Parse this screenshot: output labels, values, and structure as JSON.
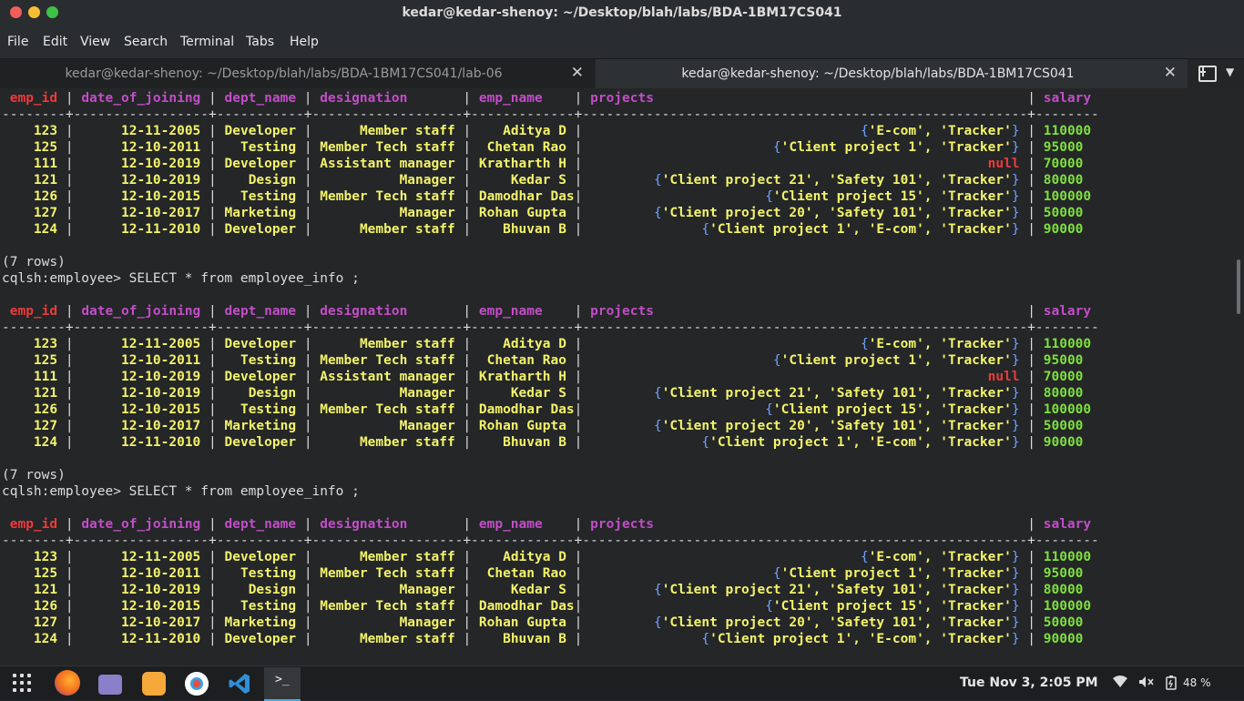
{
  "window": {
    "title": "kedar@kedar-shenoy: ~/Desktop/blah/labs/BDA-1BM17CS041"
  },
  "menubar": [
    "File",
    "Edit",
    "View",
    "Search",
    "Terminal",
    "Tabs",
    "Help"
  ],
  "tabs": [
    {
      "label": "kedar@kedar-shenoy: ~/Desktop/blah/labs/BDA-1BM17CS041/lab-06",
      "active": false
    },
    {
      "label": "kedar@kedar-shenoy: ~/Desktop/blah/labs/BDA-1BM17CS041",
      "active": true
    }
  ],
  "terminal": {
    "columns": [
      "emp_id",
      "date_of_joining",
      "dept_name",
      "designation",
      "emp_name",
      "projects",
      "salary"
    ],
    "separator": "--------+-----------------+-----------+-------------------+-------------+--------------------------------------------------------+--------",
    "row_count_text": "(7 rows)",
    "prompt": "cqlsh:employee> SELECT * from employee_info ;",
    "tables": [
      {
        "rows": [
          [
            "123",
            "12-11-2005",
            "Developer",
            "Member staff",
            "Aditya D",
            "{'E-com', 'Tracker'}",
            "110000"
          ],
          [
            "125",
            "12-10-2011",
            "Testing",
            "Member Tech staff",
            "Chetan Rao",
            "{'Client project 1', 'Tracker'}",
            "95000"
          ],
          [
            "111",
            "12-10-2019",
            "Developer",
            "Assistant manager",
            "Kratharth H",
            "null",
            "70000"
          ],
          [
            "121",
            "12-10-2019",
            "Design",
            "Manager",
            "Kedar S",
            "{'Client project 21', 'Safety 101', 'Tracker'}",
            "80000"
          ],
          [
            "126",
            "12-10-2015",
            "Testing",
            "Member Tech staff",
            "Damodhar Das",
            "{'Client project 15', 'Tracker'}",
            "100000"
          ],
          [
            "127",
            "12-10-2017",
            "Marketing",
            "Manager",
            "Rohan Gupta",
            "{'Client project 20', 'Safety 101', 'Tracker'}",
            "50000"
          ],
          [
            "124",
            "12-11-2010",
            "Developer",
            "Member staff",
            "Bhuvan B",
            "{'Client project 1', 'E-com', 'Tracker'}",
            "90000"
          ]
        ]
      },
      {
        "rows": [
          [
            "123",
            "12-11-2005",
            "Developer",
            "Member staff",
            "Aditya D",
            "{'E-com', 'Tracker'}",
            "110000"
          ],
          [
            "125",
            "12-10-2011",
            "Testing",
            "Member Tech staff",
            "Chetan Rao",
            "{'Client project 1', 'Tracker'}",
            "95000"
          ],
          [
            "111",
            "12-10-2019",
            "Developer",
            "Assistant manager",
            "Kratharth H",
            "null",
            "70000"
          ],
          [
            "121",
            "12-10-2019",
            "Design",
            "Manager",
            "Kedar S",
            "{'Client project 21', 'Safety 101', 'Tracker'}",
            "80000"
          ],
          [
            "126",
            "12-10-2015",
            "Testing",
            "Member Tech staff",
            "Damodhar Das",
            "{'Client project 15', 'Tracker'}",
            "100000"
          ],
          [
            "127",
            "12-10-2017",
            "Marketing",
            "Manager",
            "Rohan Gupta",
            "{'Client project 20', 'Safety 101', 'Tracker'}",
            "50000"
          ],
          [
            "124",
            "12-11-2010",
            "Developer",
            "Member staff",
            "Bhuvan B",
            "{'Client project 1', 'E-com', 'Tracker'}",
            "90000"
          ]
        ]
      },
      {
        "rows": [
          [
            "123",
            "12-11-2005",
            "Developer",
            "Member staff",
            "Aditya D",
            "{'E-com', 'Tracker'}",
            "110000"
          ],
          [
            "125",
            "12-10-2011",
            "Testing",
            "Member Tech staff",
            "Chetan Rao",
            "{'Client project 1', 'Tracker'}",
            "95000"
          ],
          [
            "121",
            "12-10-2019",
            "Design",
            "Manager",
            "Kedar S",
            "{'Client project 21', 'Safety 101', 'Tracker'}",
            "80000"
          ],
          [
            "126",
            "12-10-2015",
            "Testing",
            "Member Tech staff",
            "Damodhar Das",
            "{'Client project 15', 'Tracker'}",
            "100000"
          ],
          [
            "127",
            "12-10-2017",
            "Marketing",
            "Manager",
            "Rohan Gupta",
            "{'Client project 20', 'Safety 101', 'Tracker'}",
            "50000"
          ],
          [
            "124",
            "12-11-2010",
            "Developer",
            "Member staff",
            "Bhuvan B",
            "{'Client project 1', 'E-com', 'Tracker'}",
            "90000"
          ]
        ]
      }
    ]
  },
  "taskbar": {
    "apps": [
      "apps-grid-icon",
      "firefox-icon",
      "files-icon",
      "software-center-icon",
      "help-icon",
      "vscode-icon",
      "terminal-icon"
    ],
    "terminal_glyph": ">_",
    "clock": "Tue Nov  3,  2:05 PM",
    "battery": "48 %",
    "tray_icons": [
      "wifi-icon",
      "volume-muted-icon",
      "battery-icon"
    ]
  },
  "colors": {
    "header": "#c34dc8",
    "key_column": "#ec3a3a",
    "values": "#f3f36a",
    "salary": "#7ee03e",
    "null": "#ec3a3a",
    "braces": "#6ea1ff",
    "accent": "#3daee9"
  }
}
